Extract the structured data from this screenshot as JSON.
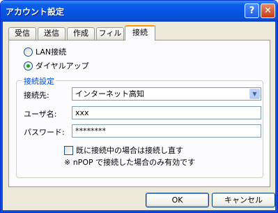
{
  "window": {
    "title": "アカウント設定"
  },
  "titlebar": {
    "help_glyph": "?",
    "close_glyph": "✕"
  },
  "tabs": [
    {
      "label": "受信"
    },
    {
      "label": "送信"
    },
    {
      "label": "作成"
    },
    {
      "label": "フィルタ"
    },
    {
      "label": "接続"
    }
  ],
  "active_tab": "接続",
  "connection": {
    "radio_lan": {
      "label": "LAN接続",
      "selected": false
    },
    "radio_dialup": {
      "label": "ダイヤルアップ",
      "selected": true
    }
  },
  "settings_group": {
    "title": "接続設定",
    "destination": {
      "label": "接続先:",
      "value": "インターネット高知"
    },
    "username": {
      "label": "ユーザ名:",
      "value": "xxx"
    },
    "password": {
      "label": "パスワード:",
      "value": "********"
    },
    "reconnect": {
      "label": "既に接続中の場合は接続し直す",
      "checked": false
    },
    "note": "※ nPOP で接続した場合のみ有効です"
  },
  "buttons": {
    "ok": "OK",
    "cancel": "キャンセル"
  },
  "colors": {
    "titlebar": "#0554e3",
    "active_tab_highlight": "#ff9a00",
    "group_title": "#0046d5"
  }
}
